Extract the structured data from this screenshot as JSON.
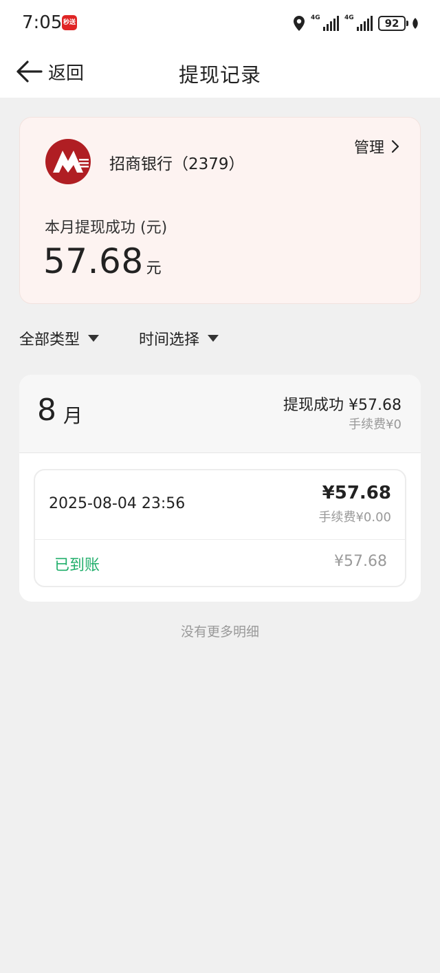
{
  "status_bar": {
    "time": "7:05",
    "notification_app": "秒送",
    "network_1": "4G",
    "network_2": "4G",
    "battery": "92"
  },
  "header": {
    "back_label": "返回",
    "title": "提现记录"
  },
  "bank_card": {
    "bank_name": "招商银行（2379）",
    "manage_label": "管理",
    "month_label": "本月提现成功 (元)",
    "month_amount": "57.68",
    "amount_unit": "元",
    "brand_color": "#b01e23"
  },
  "filters": {
    "type_label": "全部类型",
    "time_label": "时间选择"
  },
  "month_section": {
    "month_number": "8",
    "month_unit": "月",
    "summary": "提现成功 ¥57.68",
    "fee": "手续费¥0",
    "records": [
      {
        "datetime": "2025-08-04 23:56",
        "amount": "¥57.68",
        "fee": "手续费¥0.00",
        "status": "已到账",
        "received_amount": "¥57.68"
      }
    ]
  },
  "footer": {
    "no_more": "没有更多明细"
  },
  "colors": {
    "success_green": "#1fae6a",
    "card_bg": "#fdf3f1"
  }
}
